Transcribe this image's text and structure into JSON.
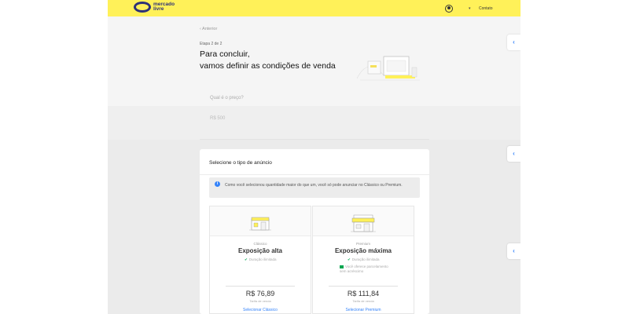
{
  "header": {
    "logo_line1": "mercado",
    "logo_line2": "livre",
    "contact_label": "Contato",
    "colors": {
      "bar": "#fff159",
      "brand": "#2d3277"
    }
  },
  "back_label": "‹ Anterior",
  "step_label": "Etapa 2 de 2",
  "title_line1": "Para concluir,",
  "title_line2": "vamos definir as condições de venda",
  "price": {
    "label": "Qual é o preço?",
    "value": "R$ 500"
  },
  "side_buttons": [
    "‹",
    "‹",
    "‹"
  ],
  "listing": {
    "title": "Selecione o tipo de anúncio",
    "info_icon": "info-icon",
    "info_text": "Como você selecionou quantidade maior do que um, você só pode anunciar no Clássico ou Premium.",
    "options": [
      {
        "tier": "Clássico",
        "name": "Exposição alta",
        "features": [
          "Duração ilimitada"
        ],
        "price": "R$ 76,89",
        "fee": "Tarifa de venda",
        "link": "Selecionar Clássico"
      },
      {
        "tier": "Premium",
        "name": "Exposição máxima",
        "features": [
          "Duração ilimitada",
          "Você oferece parcelamento sem acréscimo"
        ],
        "price": "R$ 111,84",
        "fee": "Tarifa de venda",
        "link": "Selecionar Premium"
      }
    ]
  },
  "accent_color": "#3483fa"
}
